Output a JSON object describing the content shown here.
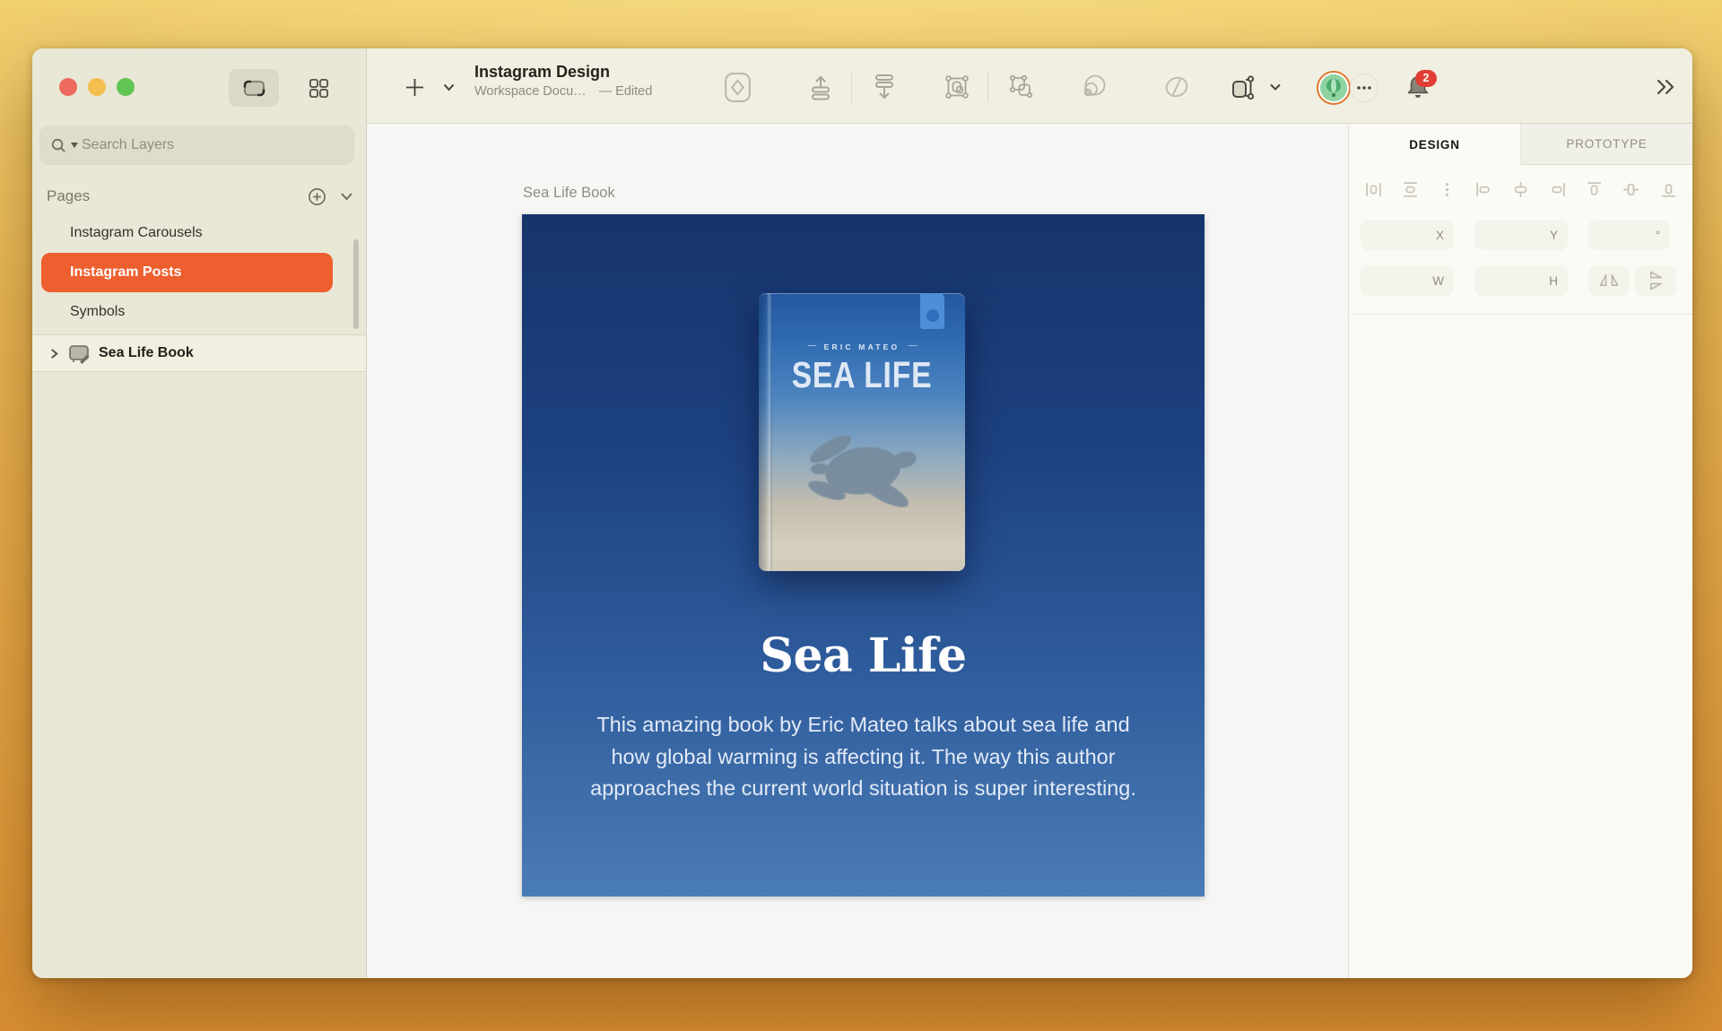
{
  "colors": {
    "accent_orange": "#EE5F30",
    "badge_red": "#E23E33",
    "artboard_gradient_top": "#16346C",
    "artboard_gradient_bottom": "#4A7CB5",
    "cover_bookmark_blue": "#4D8FD6",
    "desktop_top": "#ECC762",
    "desktop_bottom": "#D98F33"
  },
  "sidebar": {
    "search": {
      "placeholder": "Search Layers",
      "icon": "search-icon"
    },
    "view_toggles": [
      {
        "icon": "canvas-view-icon",
        "active": true
      },
      {
        "icon": "grid-view-icon",
        "active": false
      }
    ],
    "pages_header": {
      "label": "Pages",
      "add_icon": "add-page-icon",
      "collapse_icon": "chevron-down-icon"
    },
    "pages": [
      {
        "label": "Instagram Carousels",
        "selected": false
      },
      {
        "label": "Instagram Posts",
        "selected": true
      },
      {
        "label": "Symbols",
        "selected": false
      }
    ],
    "layers": [
      {
        "label": "Sea Life Book",
        "icon": "artboard-layer-icon",
        "expand_icon": "chevron-right-icon"
      }
    ]
  },
  "toolbar": {
    "insert": {
      "plus_icon": "plus-icon",
      "chevron_icon": "chevron-down-icon"
    },
    "document": {
      "title": "Instagram Design",
      "subtitle": "Workspace Docu…",
      "status": "— Edited"
    },
    "tool_icons": [
      "create-symbol-icon",
      "bring-forward-icon",
      "send-backward-icon",
      "group-icon",
      "ungroup-icon",
      "shell-icon",
      "mask-icon",
      "resize-icon",
      "chevron-down-icon"
    ],
    "avatar_icon": "user-avatar",
    "more_icon": "ellipsis-icon",
    "bell_icon": "bell-icon",
    "notification_count": "2",
    "overflow_icon": "double-chevron-right-icon"
  },
  "inspector": {
    "tabs": [
      {
        "label": "DESIGN",
        "active": true
      },
      {
        "label": "PROTOTYPE",
        "active": false
      }
    ],
    "align_icons": [
      "distribute-horizontal-icon",
      "distribute-vertical-icon",
      "more-options-icon",
      "align-left-icon",
      "align-center-horizontal-icon",
      "align-right-icon",
      "align-top-icon",
      "align-middle-vertical-icon",
      "align-bottom-icon"
    ],
    "fields": {
      "x": "X",
      "y": "Y",
      "rotation": "°",
      "width": "W",
      "height": "H"
    },
    "flip_icons": [
      "flip-horizontal-icon",
      "flip-vertical-icon"
    ]
  },
  "canvas": {
    "artboard_label": "Sea Life Book",
    "artboard": {
      "book_cover": {
        "author": "ERIC MATEO",
        "title": "SEA LIFE",
        "decor": "~~"
      },
      "heading": "Sea Life",
      "description": "This amazing book by Eric Mateo talks about sea life and how global warming is affecting it. The way this author approaches the current world situation is super interesting."
    }
  }
}
